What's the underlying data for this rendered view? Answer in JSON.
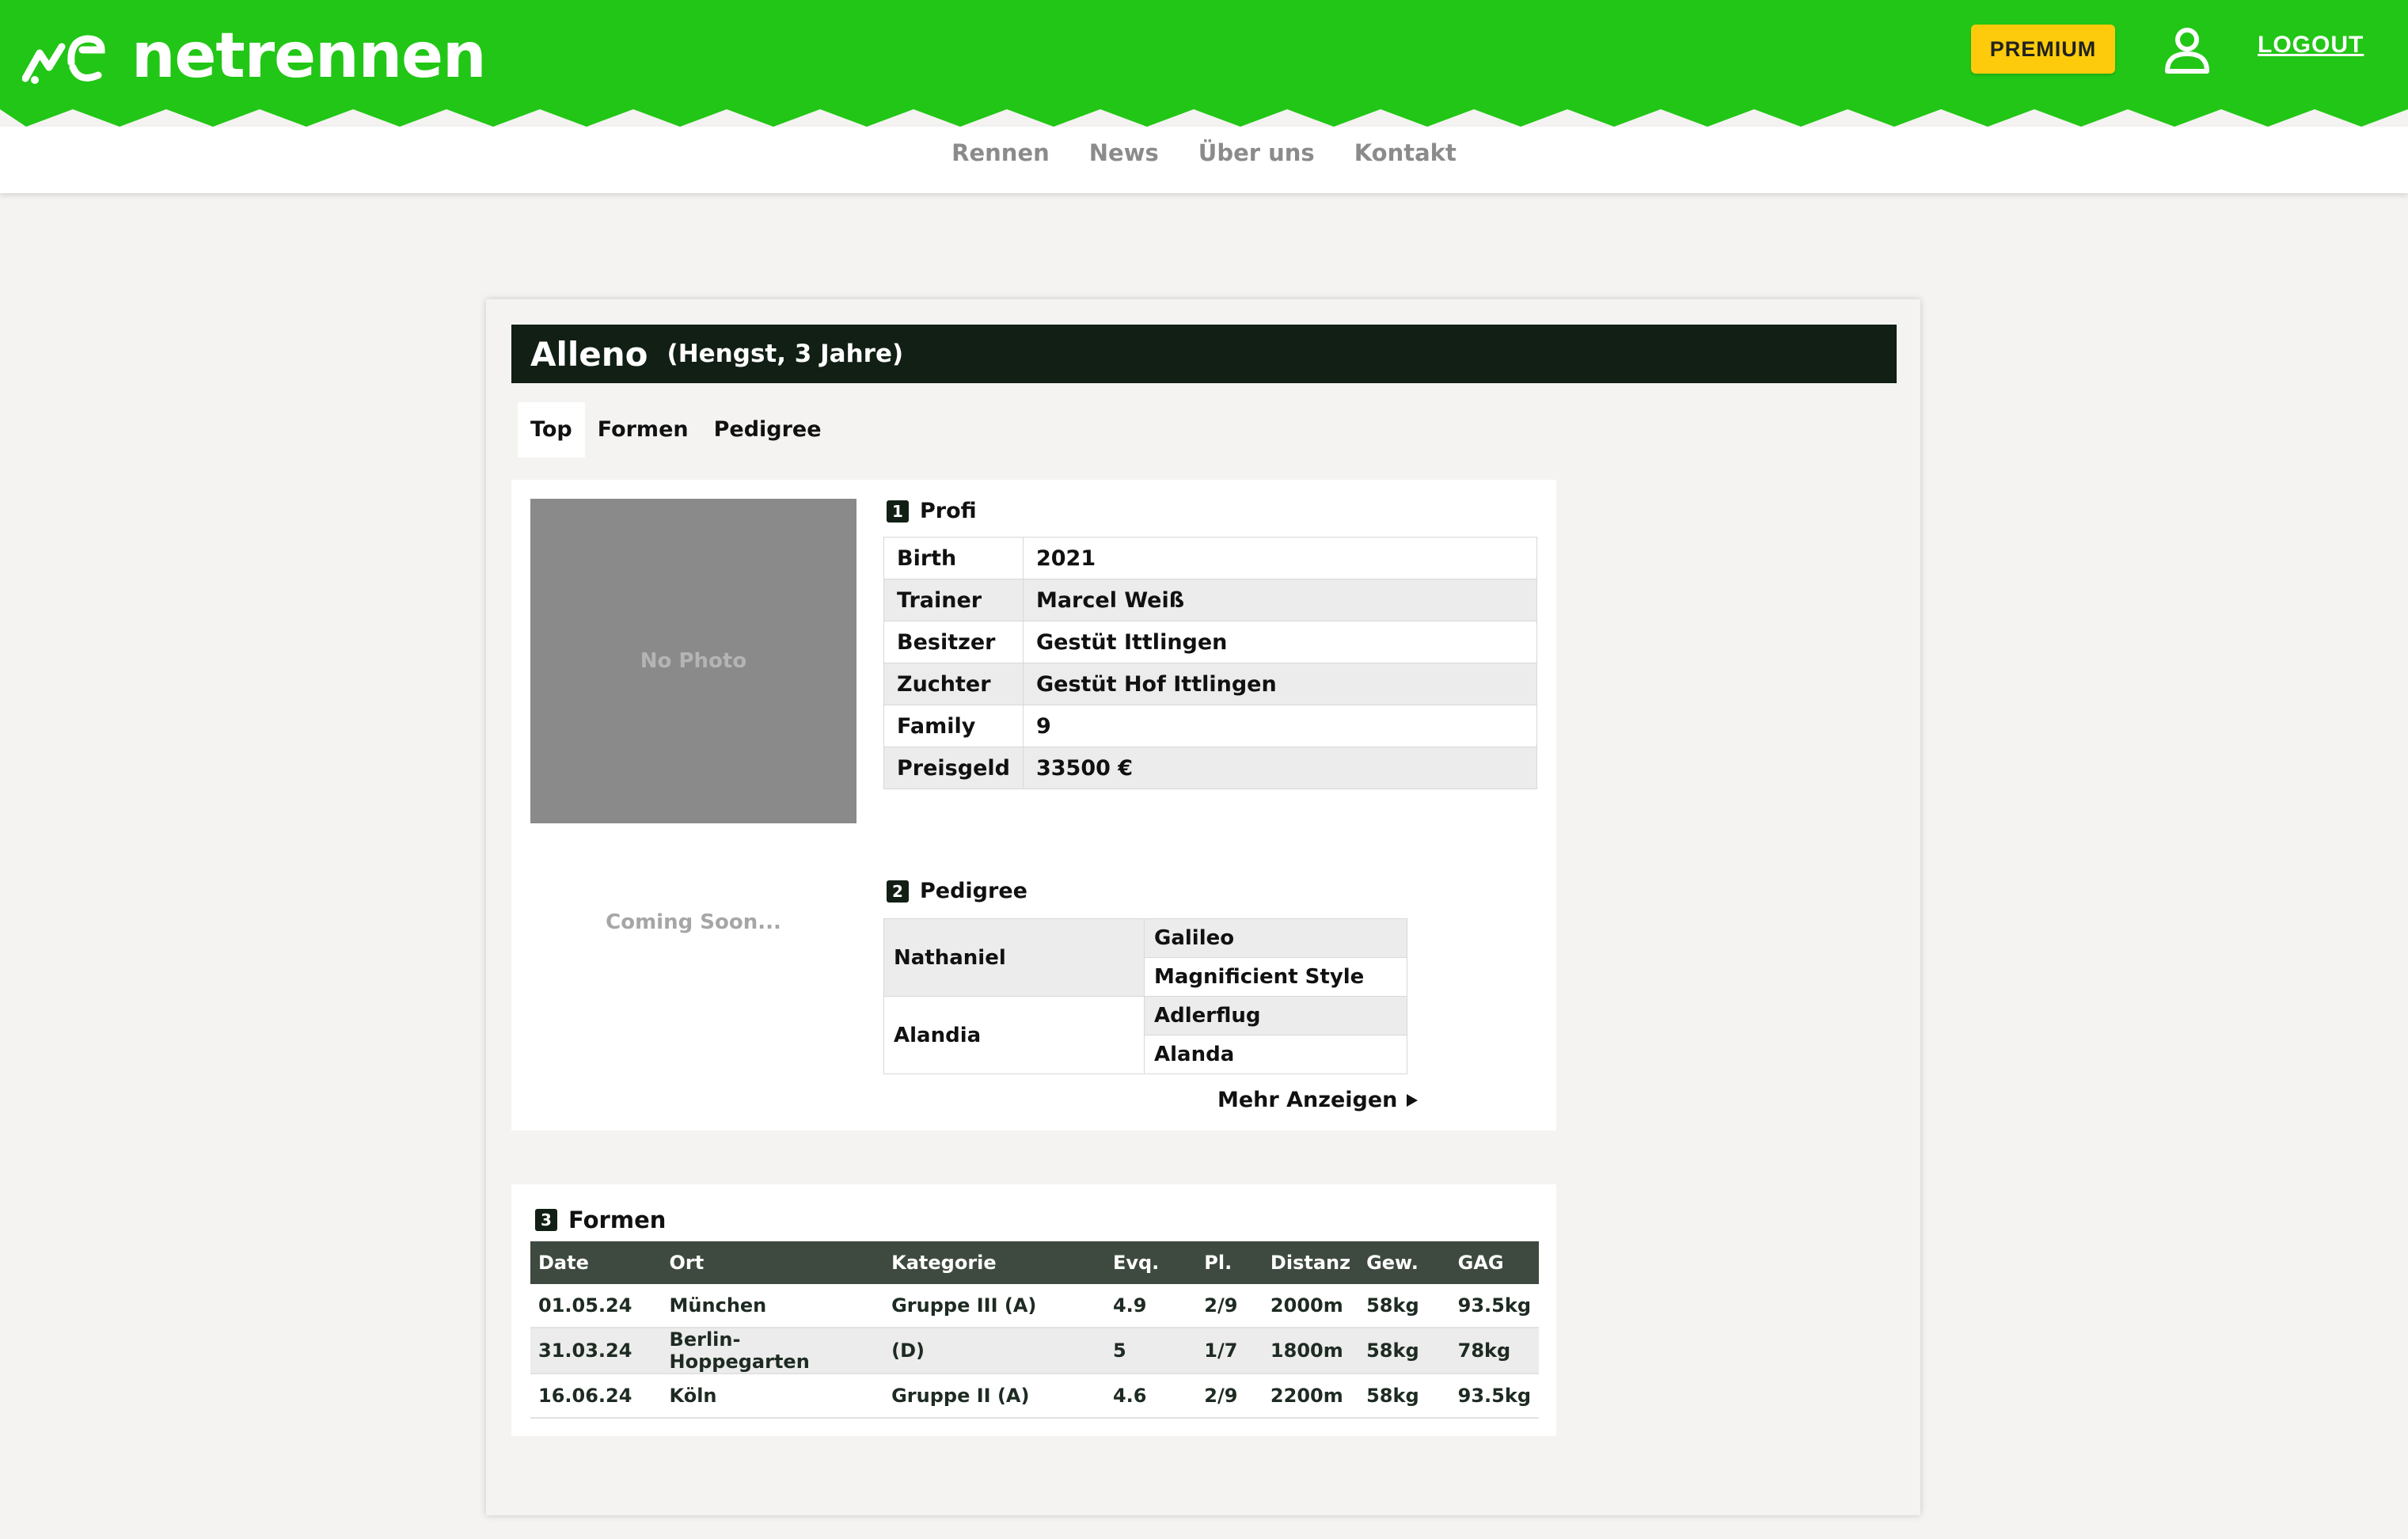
{
  "colors": {
    "brand_green": "#22c616",
    "premium_yellow": "#fdcb0b",
    "title_bar": "#111f15",
    "table_head": "#3e4a3f"
  },
  "header": {
    "brand": "netrennen",
    "premium_label": "PREMIUM",
    "logout_label": "LOGOUT",
    "nav": [
      "Rennen",
      "News",
      "Über uns",
      "Kontakt"
    ]
  },
  "horse": {
    "name": "Alleno",
    "subtitle": "(Hengst, 3 Jahre)"
  },
  "tabs": [
    "Top",
    "Formen",
    "Pedigree"
  ],
  "photo": {
    "placeholder": "No Photo",
    "coming_soon": "Coming Soon..."
  },
  "profi": {
    "number": "1",
    "title": "Profi",
    "rows": [
      {
        "key": "Birth",
        "value": "2021"
      },
      {
        "key": "Trainer",
        "value": "Marcel Weiß"
      },
      {
        "key": "Besitzer",
        "value": "Gestüt Ittlingen"
      },
      {
        "key": "Zuchter",
        "value": "Gestüt Hof Ittlingen"
      },
      {
        "key": "Family",
        "value": "9"
      },
      {
        "key": "Preisgeld",
        "value": "33500 €"
      }
    ]
  },
  "pedigree": {
    "number": "2",
    "title": "Pedigree",
    "sire": "Nathaniel",
    "sire_sire": "Galileo",
    "sire_dam": "Magnificient Style",
    "dam": "Alandia",
    "dam_sire": "Adlerflug",
    "dam_dam": "Alanda",
    "more_label": "Mehr Anzeigen"
  },
  "formen": {
    "number": "3",
    "title": "Formen",
    "headers": [
      "Date",
      "Ort",
      "Kategorie",
      "Evq.",
      "Pl.",
      "Distanz",
      "Gew.",
      "GAG"
    ],
    "rows": [
      [
        "01.05.24",
        "München",
        "Gruppe III (A)",
        "4.9",
        "2/9",
        "2000m",
        "58kg",
        "93.5kg"
      ],
      [
        "31.03.24",
        "Berlin-Hoppegarten",
        "(D)",
        "5",
        "1/7",
        "1800m",
        "58kg",
        "78kg"
      ],
      [
        "16.06.24",
        "Köln",
        "Gruppe II (A)",
        "4.6",
        "2/9",
        "2200m",
        "58kg",
        "93.5kg"
      ]
    ]
  }
}
